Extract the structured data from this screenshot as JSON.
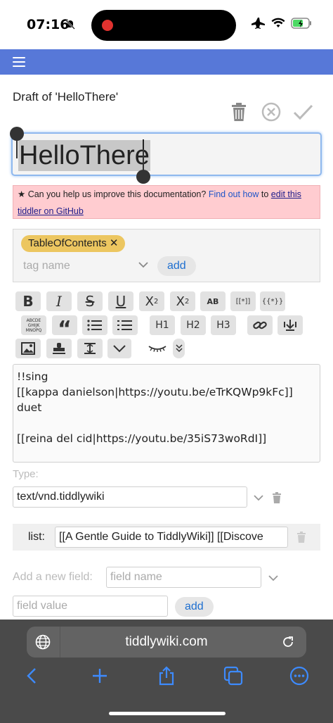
{
  "status_bar": {
    "time": "07:16"
  },
  "nav": {
    "menu_icon": "hamburger-icon"
  },
  "draft": {
    "heading": "Draft of 'HelloThere'",
    "title_value": "HelloThere"
  },
  "banner": {
    "prefix": "Can you help us improve this documentation?",
    "find_out_link": "Find out how",
    "middle": "to",
    "edit_link_line1": "edit this",
    "edit_link_line2": "tiddler on GitHub"
  },
  "tags": {
    "existing": "TableOfContents",
    "placeholder": "tag name",
    "add_label": "add"
  },
  "toolbar": {
    "row1": [
      "B",
      "I",
      "S",
      "U",
      "X2",
      "X2",
      "AB",
      "[[*]]",
      "{{*}}"
    ],
    "row2": [
      "ABCDE",
      "“",
      "list",
      "numlist",
      "H1",
      "H2",
      "H3",
      "link",
      "transclude"
    ],
    "row3": [
      "picture",
      "stamp",
      "size",
      "more",
      "preview",
      "overflow"
    ]
  },
  "editor": {
    "text": "!!sing\n[[kappa danielson|https://youtu.be/eTrKQWp9kFc]]\nduet\n\n[[reina del cid|https://youtu.be/35iS73woRdI]]"
  },
  "type_field": {
    "label": "Type:",
    "value": "text/vnd.tiddlywiki"
  },
  "list_field": {
    "label": "list:",
    "value": "[[A Gentle Guide to TiddlyWiki]] [[Discove"
  },
  "new_field": {
    "label": "Add a new field:",
    "name_placeholder": "field name",
    "value_placeholder": "field value",
    "add_label": "add"
  },
  "browser": {
    "url": "tiddlywiki.com"
  },
  "colors": {
    "nav_blue": "#5778d8",
    "banner_pink": "#ffccd0",
    "tag_yellow": "#ecc660",
    "link_blue": "#1e55c8",
    "safari_blue": "#3d8bff"
  }
}
